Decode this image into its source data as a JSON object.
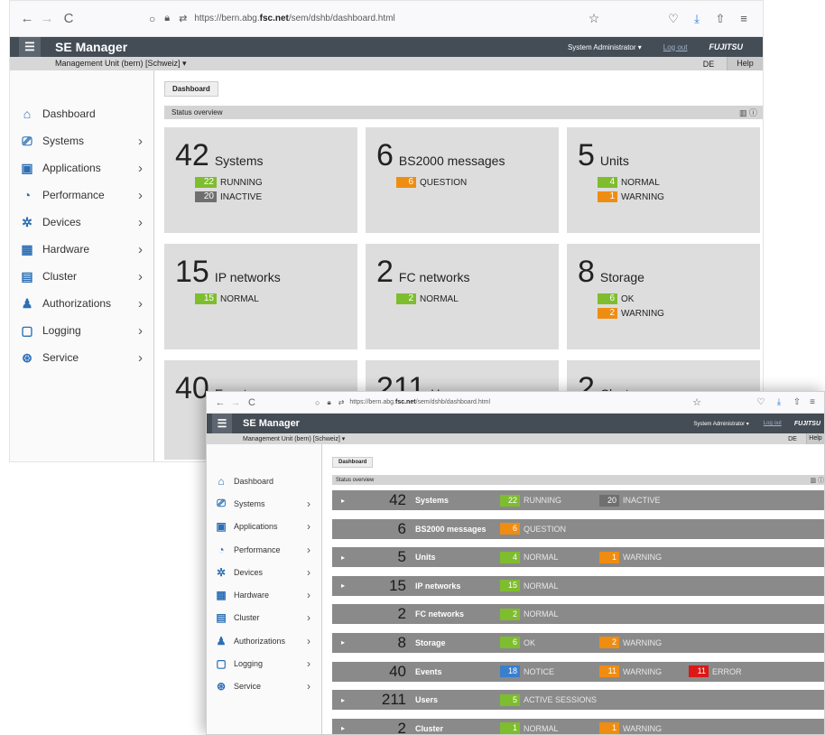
{
  "browser": {
    "url_prefix": "https://bern.abg.",
    "url_domain": "fsc.net",
    "url_path": "/sem/dshb/dashboard.html",
    "back_icon": "←",
    "forward_icon": "→",
    "reload_icon": "C"
  },
  "app": {
    "title": "SE Manager",
    "user": "System Administrator ▾",
    "logout": "Log out",
    "brand": "FUJITSU",
    "unit": "Management Unit (bern) [Schweiz] ▾",
    "lang": "DE",
    "help": "Help"
  },
  "tab": "Dashboard",
  "status_title": "Status overview",
  "sidebar": [
    {
      "label": "Dashboard",
      "icon": "⌂",
      "chev": ""
    },
    {
      "label": "Systems",
      "icon": "⎚",
      "chev": "›"
    },
    {
      "label": "Applications",
      "icon": "▣",
      "chev": "›"
    },
    {
      "label": "Performance",
      "icon": "◔",
      "chev": "›"
    },
    {
      "label": "Devices",
      "icon": "✲",
      "chev": "›"
    },
    {
      "label": "Hardware",
      "icon": "▦",
      "chev": "›"
    },
    {
      "label": "Cluster",
      "icon": "▤",
      "chev": "›"
    },
    {
      "label": "Authorizations",
      "icon": "♟",
      "chev": "›"
    },
    {
      "label": "Logging",
      "icon": "▢",
      "chev": "›"
    },
    {
      "label": "Service",
      "icon": "⊛",
      "chev": "›"
    }
  ],
  "cards": [
    {
      "num": "42",
      "label": "Systems",
      "badges": [
        {
          "v": "22",
          "t": "RUNNING",
          "c": "g"
        },
        {
          "v": "20",
          "t": "INACTIVE",
          "c": "dg"
        }
      ]
    },
    {
      "num": "6",
      "label": "BS2000 messages",
      "badges": [
        {
          "v": "6",
          "t": "QUESTION",
          "c": "o"
        }
      ]
    },
    {
      "num": "5",
      "label": "Units",
      "badges": [
        {
          "v": "4",
          "t": "NORMAL",
          "c": "g"
        },
        {
          "v": "1",
          "t": "WARNING",
          "c": "o"
        }
      ]
    },
    {
      "num": "15",
      "label": "IP networks",
      "badges": [
        {
          "v": "15",
          "t": "NORMAL",
          "c": "g"
        }
      ]
    },
    {
      "num": "2",
      "label": "FC networks",
      "badges": [
        {
          "v": "2",
          "t": "NORMAL",
          "c": "g"
        }
      ]
    },
    {
      "num": "8",
      "label": "Storage",
      "badges": [
        {
          "v": "6",
          "t": "OK",
          "c": "g"
        },
        {
          "v": "2",
          "t": "WARNING",
          "c": "o"
        }
      ]
    },
    {
      "num": "40",
      "label": "Events",
      "badges": []
    },
    {
      "num": "211",
      "label": "Users",
      "badges": []
    },
    {
      "num": "2",
      "label": "Cluster",
      "badges": []
    }
  ],
  "list": [
    {
      "exp": "▸",
      "num": "42",
      "label": "Systems",
      "badges": [
        {
          "v": "22",
          "t": "RUNNING",
          "c": "g"
        },
        {
          "v": "20",
          "t": "INACTIVE",
          "c": "dg"
        }
      ]
    },
    {
      "exp": "",
      "num": "6",
      "label": "BS2000 messages",
      "badges": [
        {
          "v": "6",
          "t": "QUESTION",
          "c": "o"
        }
      ]
    },
    {
      "exp": "▸",
      "num": "5",
      "label": "Units",
      "badges": [
        {
          "v": "4",
          "t": "NORMAL",
          "c": "g"
        },
        {
          "v": "1",
          "t": "WARNING",
          "c": "o"
        }
      ]
    },
    {
      "exp": "▸",
      "num": "15",
      "label": "IP networks",
      "badges": [
        {
          "v": "15",
          "t": "NORMAL",
          "c": "g"
        }
      ]
    },
    {
      "exp": "",
      "num": "2",
      "label": "FC networks",
      "badges": [
        {
          "v": "2",
          "t": "NORMAL",
          "c": "g"
        }
      ]
    },
    {
      "exp": "▸",
      "num": "8",
      "label": "Storage",
      "badges": [
        {
          "v": "6",
          "t": "OK",
          "c": "g"
        },
        {
          "v": "2",
          "t": "WARNING",
          "c": "o"
        }
      ]
    },
    {
      "exp": "",
      "num": "40",
      "label": "Events",
      "badges": [
        {
          "v": "18",
          "t": "NOTICE",
          "c": "b"
        },
        {
          "v": "11",
          "t": "WARNING",
          "c": "o"
        },
        {
          "v": "11",
          "t": "ERROR",
          "c": "r"
        }
      ]
    },
    {
      "exp": "▸",
      "num": "211",
      "label": "Users",
      "badges": [
        {
          "v": "5",
          "t": "ACTIVE SESSIONS",
          "c": "g"
        }
      ]
    },
    {
      "exp": "▸",
      "num": "2",
      "label": "Cluster",
      "badges": [
        {
          "v": "1",
          "t": "NORMAL",
          "c": "g"
        },
        {
          "v": "1",
          "t": "WARNING",
          "c": "o"
        }
      ]
    }
  ],
  "colors": {
    "header": "#444c55",
    "green": "#7ebd2e",
    "orange": "#ef8d12",
    "gray": "#6f6f6f",
    "blue": "#3a7fce",
    "red": "#dc1717"
  }
}
